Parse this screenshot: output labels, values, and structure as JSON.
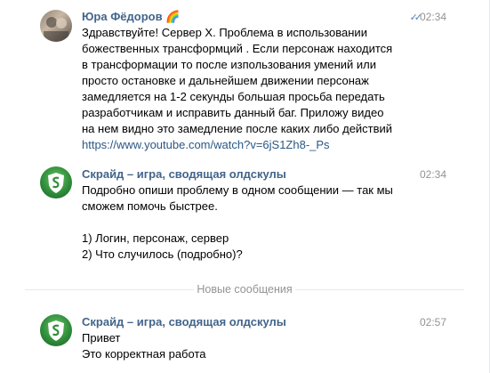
{
  "messages": [
    {
      "author": "Юра Фёдоров",
      "emoji": "🌈",
      "time": "02:34",
      "read_icon": "double-check-icon",
      "lines": [
        "Здравствуйте! Сервер Х. Проблема в использовании",
        "божественных трансформций . Если персонаж находится",
        "в трансформации то после изпользования умений или",
        "просто остановке и дальнейшем движении персонаж",
        "замедляется на 1-2 секунды большая просьба передать",
        "разработчикам и исправить данный баг. Приложу видео",
        "на нем видно это замедление после каких либо действий"
      ],
      "link": "https://www.youtube.com/watch?v=6jS1Zh8-_Ps"
    },
    {
      "author": "Скрайд – игра, сводящая олдскулы",
      "time": "02:34",
      "lines": [
        "Подробно опиши проблему в одном сообщении — так мы",
        "сможем помочь быстрее.",
        "",
        "1) Логин, персонаж, сервер",
        "2) Что случилось (подробно)?"
      ]
    },
    {
      "author": "Скрайд – игра, сводящая олдскулы",
      "time": "02:57",
      "lines": [
        "Привет",
        "Это корректная работа"
      ]
    }
  ],
  "divider": {
    "label": "Новые сообщения"
  },
  "colors": {
    "author": "#42648b",
    "link": "#2a5885",
    "time": "#939393",
    "check": "#5181b8"
  }
}
